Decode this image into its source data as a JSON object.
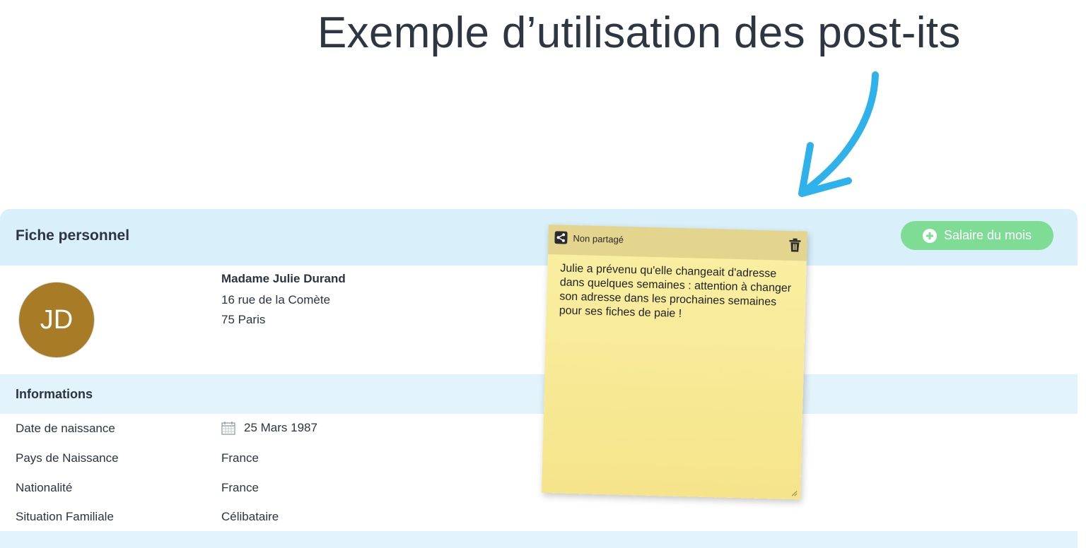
{
  "headline": "Exemple d’utilisation des post-its",
  "card": {
    "title": "Fiche personnel",
    "salary_button": "Salaire du mois",
    "avatar_initials": "JD",
    "person": {
      "name": "Madame Julie Durand",
      "address_line1": "16 rue de la Comète",
      "address_line2": "75 Paris"
    },
    "section_title": "Informations",
    "info": [
      {
        "label": "Date de naissance",
        "value": "25 Mars 1987"
      },
      {
        "label": "Pays de Naissance",
        "value": "France"
      },
      {
        "label": "Nationalité",
        "value": "France"
      },
      {
        "label": "Situation Familiale",
        "value": "Célibataire"
      }
    ]
  },
  "postit": {
    "status": "Non partagé",
    "text": "Julie a prévenu qu'elle changeait d'adresse dans quelques semaines : attention à changer son adresse dans les prochaines semaines pour ses fiches de paie !"
  },
  "colors": {
    "header_bg": "#d9f0fb",
    "accent_green": "#7fdc94",
    "avatar_bg": "#a87b26",
    "postit_bg": "#f7e890",
    "arrow": "#2fb2ec"
  },
  "icons": [
    "share-icon",
    "trash-icon",
    "plus-circle-icon",
    "calendar-icon",
    "curved-arrow-icon",
    "resize-handle-icon"
  ]
}
